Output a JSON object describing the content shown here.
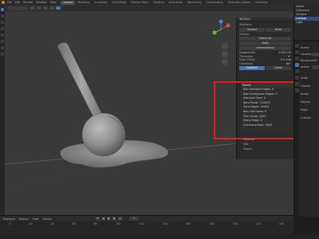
{
  "menu": {
    "items": [
      "File",
      "Edit",
      "Render",
      "Window",
      "Help"
    ]
  },
  "workspace_tabs": [
    "Layout",
    "Modeling",
    "Sculpting",
    "UV Editing",
    "Texture Paint",
    "Shading",
    "Animation",
    "Rendering",
    "Compositing",
    "Geometry Nodes",
    "Scripting"
  ],
  "viewport": {
    "mode": "Object Mode"
  },
  "npanel": {
    "header": "3D-Print",
    "statistics_label": "Statistics",
    "volume_label": "Volume",
    "area_label": "Area",
    "checks_label": "Checks",
    "check_all": "Check All",
    "solid_label": "Solid",
    "intersections_label": "Intersections",
    "degenerate_label": "Degenerate",
    "thickness_label": "Thickness",
    "edge_sharp_label": "Edge Sharp",
    "overhang_label": "Overhang",
    "buttons": [
      "Isolated",
      "Clean"
    ],
    "values": [
      "0.021 m³",
      "0°",
      "0.1 mm",
      "45°"
    ]
  },
  "report": {
    "title": "Result",
    "items": [
      "Non Manifold Edges: 0",
      "Bad Contiguous Edges: 0",
      "Intersect Face: 0",
      "Zero Faces: 122923",
      "Zero Edges: 25424",
      "Non Flat Faces: 0",
      "Thin Faces: 1457",
      "Sharp Edge: 0",
      "Overhang Face: 2633"
    ]
  },
  "sub_list": [
    "Cleanup",
    "Edit",
    "Export"
  ],
  "outliner": {
    "items": [
      "Scene",
      "Collection",
      "Camera",
      "Lollipop",
      "Light"
    ]
  },
  "properties": {
    "rows": [
      "Scene",
      "Camera",
      "Background",
      "Active",
      "Units",
      "Gravity",
      "Audio",
      "Keying",
      "Rigid",
      "Custom"
    ]
  },
  "timeline": {
    "menus": [
      "Playback",
      "Keying",
      "View",
      "Marker"
    ],
    "frame": "1",
    "ruler": [
      "0",
      "20",
      "40",
      "60",
      "80",
      "100",
      "120",
      "140",
      "160",
      "180",
      "200",
      "220",
      "240"
    ]
  },
  "colors": {
    "accent": "#4772b3",
    "highlight_border": "#e21b1b",
    "object": "#8d8d8d"
  },
  "icons": [
    "blender-logo-icon",
    "navigation-gizmo-icon",
    "zoom-icon",
    "pan-icon",
    "camera-icon"
  ]
}
